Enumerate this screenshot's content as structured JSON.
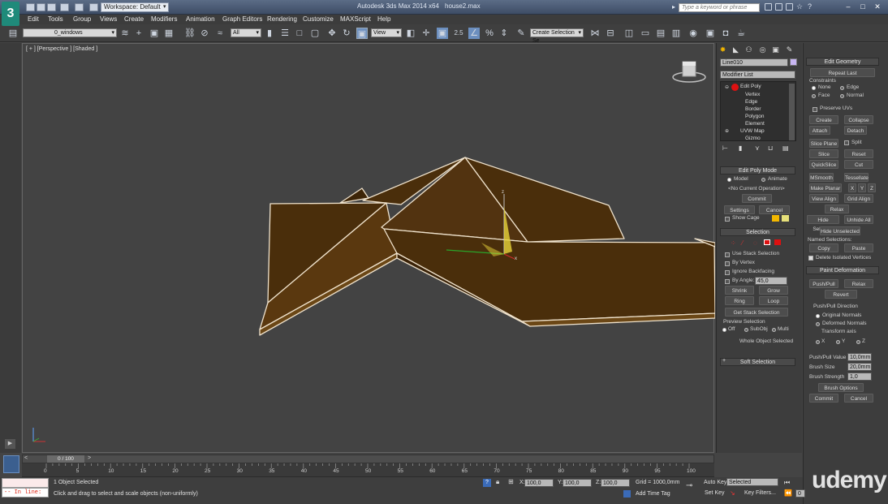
{
  "titlebar": {
    "app_title": "Autodesk 3ds Max 2014 x64",
    "doc_title": "house2.max",
    "workspace": "Workspace: Default",
    "search_placeholder": "Type a keyword or phrase",
    "logo": "3"
  },
  "menu": [
    "Edit",
    "Tools",
    "Group",
    "Views",
    "Create",
    "Modifiers",
    "Animation",
    "Graph Editors",
    "Rendering",
    "Customize",
    "MAXScript",
    "Help"
  ],
  "toolbar": {
    "layer_dropdown": "0_windows",
    "selection_filter": "All",
    "reference_coord": "View",
    "named_selection": "Create Selection Se",
    "snap_labels": [
      "2.5",
      "%"
    ]
  },
  "viewport": {
    "label": "[ + ] [Perspective ] [Shaded ]",
    "gizmo_axis": "z",
    "gizmo_x": "x"
  },
  "command_panel": {
    "object_name": "Line010",
    "modifier_list": "Modifier List",
    "stack": [
      {
        "label": "Edit Poly",
        "level": 0
      },
      {
        "label": "Vertex",
        "level": 1
      },
      {
        "label": "Edge",
        "level": 1
      },
      {
        "label": "Border",
        "level": 1
      },
      {
        "label": "Polygon",
        "level": 1
      },
      {
        "label": "Element",
        "level": 1
      },
      {
        "label": "UVW Map",
        "level": 0
      },
      {
        "label": "Gizmo",
        "level": 1
      }
    ],
    "edit_poly_mode": {
      "title": "Edit Poly Mode",
      "model": "Model",
      "animate": "Animate",
      "current_op": "<No Current Operation>",
      "commit": "Commit",
      "settings": "Settings",
      "cancel": "Cancel",
      "show_cage": "Show Cage"
    },
    "selection": {
      "title": "Selection",
      "use_stack": "Use Stack Selection",
      "by_vertex": "By Vertex",
      "ignore_backfacing": "Ignore Backfacing",
      "by_angle": "By Angle:",
      "angle_value": "45,0",
      "shrink": "Shrink",
      "grow": "Grow",
      "ring": "Ring",
      "loop": "Loop",
      "get_stack": "Get Stack Selection",
      "preview_title": "Preview Selection",
      "off": "Off",
      "subobj": "SubObj",
      "multi": "Multi",
      "whole_object": "Whole Object Selected"
    },
    "soft_selection": "Soft Selection"
  },
  "right_panel": {
    "edit_geometry": "Edit Geometry",
    "repeat_last": "Repeat Last",
    "constraints": "Constraints",
    "none": "None",
    "edge": "Edge",
    "face": "Face",
    "normal": "Normal",
    "preserve_uvs": "Preserve UVs",
    "create": "Create",
    "collapse": "Collapse",
    "attach": "Attach",
    "detach": "Detach",
    "slice_plane": "Slice Plane",
    "split": "Split",
    "slice": "Slice",
    "reset_plane": "Reset Plane",
    "quickslice": "QuickSlice",
    "cut": "Cut",
    "msmooth": "MSmooth",
    "tessellate": "Tessellate",
    "make_planar": "Make Planar",
    "x": "X",
    "y": "Y",
    "z": "Z",
    "view_align": "View Align",
    "grid_align": "Grid Align",
    "relax": "Relax",
    "hide_selected": "Hide Selected",
    "unhide_all": "Unhide All",
    "hide_unselected": "Hide Unselected",
    "named_selections": "Named Selections:",
    "copy": "Copy",
    "paste": "Paste",
    "delete_isolated": "Delete Isolated Vertices",
    "paint_deformation": "Paint Deformation",
    "push_pull": "Push/Pull",
    "relax2": "Relax",
    "revert": "Revert",
    "pp_direction": "Push/Pull Direction",
    "original_normals": "Original Normals",
    "deformed_normals": "Deformed Normals",
    "transform_axis": "Transform axis",
    "pp_value_label": "Push/Pull Value",
    "pp_value": "10,0mm",
    "brush_size_label": "Brush Size",
    "brush_size": "20,0mm",
    "brush_strength_label": "Brush Strength",
    "brush_strength": "1,0",
    "brush_options": "Brush Options",
    "commit": "Commit",
    "cancel": "Cancel"
  },
  "timeline": {
    "frame": "0 / 100",
    "ticks": [
      "0",
      "5",
      "10",
      "15",
      "20",
      "25",
      "30",
      "35",
      "40",
      "45",
      "50",
      "55",
      "60",
      "65",
      "70",
      "75",
      "80",
      "85",
      "90",
      "95",
      "100"
    ]
  },
  "status": {
    "maxscript": "-- In line:",
    "selected": "1 Object Selected",
    "prompt": "Click and drag to select and scale objects (non-uniformly)",
    "x_label": "X:",
    "x": "100,0",
    "y_label": "Y:",
    "y": "100,0",
    "z_label": "Z:",
    "z": "100,0",
    "grid": "Grid = 1000,0mm",
    "add_time_tag": "Add Time Tag",
    "auto_key": "Auto Key",
    "set_key": "Set Key",
    "key_mode": "Selected",
    "key_filters": "Key Filters...",
    "frame_field": "0"
  },
  "watermark": "udemy",
  "colors": {
    "roof_fill": "#4a2e0b",
    "roof_edge": "#e8dcc8",
    "viewport_bg": "#434343",
    "selection_red": "#cc1111"
  }
}
